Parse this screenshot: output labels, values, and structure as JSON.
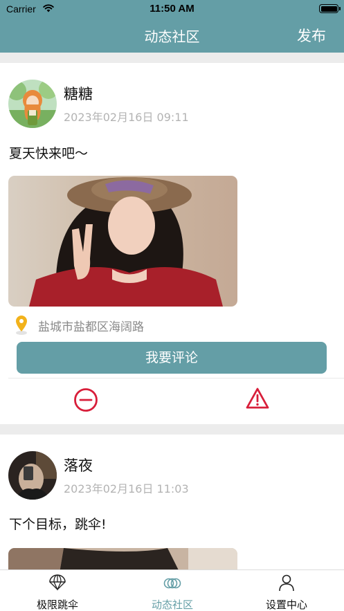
{
  "status_bar": {
    "carrier": "Carrier",
    "time": "11:50 AM"
  },
  "nav": {
    "title": "动态社区",
    "publish_label": "发布"
  },
  "posts": [
    {
      "username": "糖糖",
      "datetime": "2023年02月16日   09:11",
      "content": "夏天快来吧～",
      "location": "盐城市盐都区海阔路",
      "comment_label": "我要评论"
    },
    {
      "username": "落夜",
      "datetime": "2023年02月16日   11:03",
      "content": "下个目标，跳伞!"
    }
  ],
  "tabs": [
    {
      "label": "极限跳伞",
      "icon": "parachute-icon"
    },
    {
      "label": "动态社区",
      "icon": "community-rings-icon",
      "active": true
    },
    {
      "label": "设置中心",
      "icon": "person-icon"
    }
  ],
  "colors": {
    "accent": "#649ea6",
    "alert_red": "#d81e3a",
    "location_pin": "#f2b21b",
    "muted_text": "#b3b3b3",
    "background": "#ececec"
  }
}
